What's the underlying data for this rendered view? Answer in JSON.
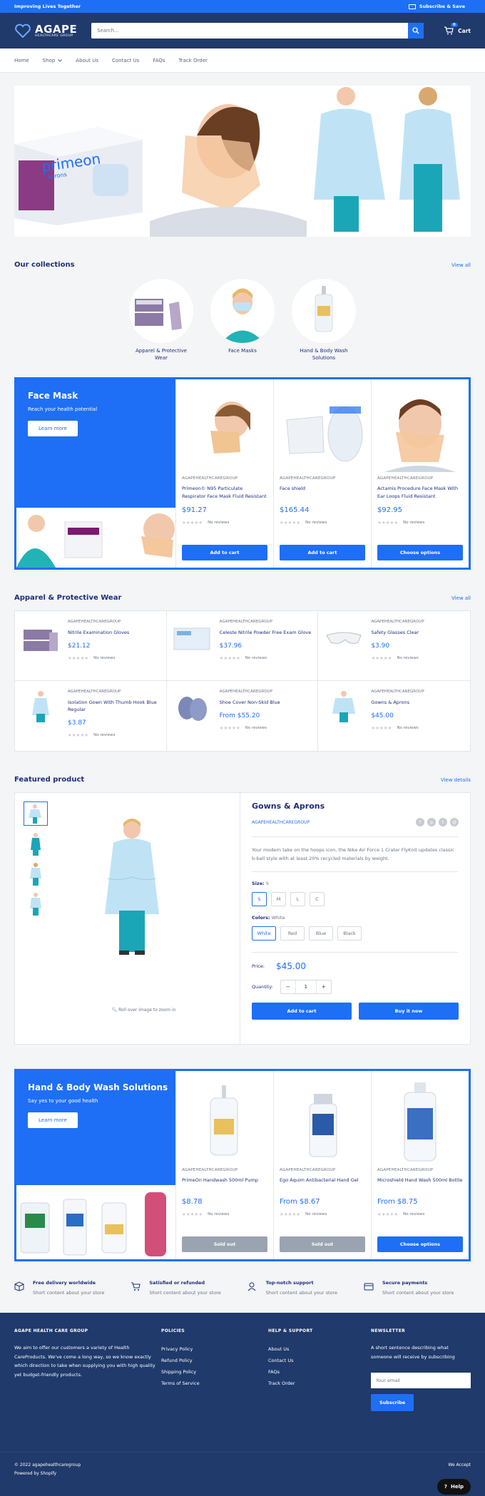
{
  "topbar": {
    "left": "Improving Lives Together",
    "right": "Subscribe & Save"
  },
  "header": {
    "logo": "AGAPE",
    "logo_sub": "HEALTHCARE GROUP",
    "search_placeholder": "Search...",
    "cart_label": "Cart",
    "cart_count": "0"
  },
  "nav": {
    "items": [
      "Home",
      "Shop",
      "About Us",
      "Contact Us",
      "FAQs",
      "Track Order"
    ]
  },
  "hero": {
    "box_brand": "primeon",
    "box_sub": "Aprons"
  },
  "collections": {
    "title": "Our collections",
    "view_all": "View all",
    "items": [
      "Apparel & Protective Wear",
      "Face Masks",
      "Hand & Body Wash Solutions"
    ]
  },
  "promo1": {
    "title": "Face Mask",
    "subtitle": "Reach your health potential",
    "button": "Learn more",
    "products": [
      {
        "vendor": "AGAPEHEALTHCAREGROUP",
        "name": "Primeon© N95 Particulate Respirator Face Mask Fluid Resistant",
        "price": "$91.27",
        "reviews": "No reviews",
        "button": "Add to cart"
      },
      {
        "vendor": "AGAPEHEALTHCAREGROUP",
        "name": "Face shield",
        "price": "$165.44",
        "reviews": "No reviews",
        "button": "Add to cart"
      },
      {
        "vendor": "AGAPEHEALTHCAREGROUP",
        "name": "Actamis Procedure Face Mask With Ear Loops Fluid Resistant",
        "price": "$92.95",
        "reviews": "No reviews",
        "button": "Choose options"
      }
    ]
  },
  "apparel": {
    "title": "Apparel & Protective Wear",
    "view_all": "View all",
    "items": [
      {
        "vendor": "AGAPEHEALTHCAREGROUP",
        "name": "Nitrile Examination Gloves",
        "price": "$21.12",
        "reviews": "No reviews"
      },
      {
        "vendor": "AGAPEHEALTHCAREGROUP",
        "name": "Celeste Nitrile Powder Free Exam Glove",
        "price": "$37.96",
        "reviews": "No reviews"
      },
      {
        "vendor": "AGAPEHEALTHCAREGROUP",
        "name": "Safety Glasses Clear",
        "price": "$3.90",
        "reviews": "No reviews"
      },
      {
        "vendor": "AGAPEHEALTHCAREGROUP",
        "name": "Isolation Gown With Thumb Hook Blue Regular",
        "price": "$3.87",
        "reviews": "No reviews"
      },
      {
        "vendor": "AGAPEHEALTHCAREGROUP",
        "name": "Shoe Cover Non-Skid Blue",
        "price": "From $55.20",
        "reviews": "No reviews"
      },
      {
        "vendor": "AGAPEHEALTHCAREGROUP",
        "name": "Gowns & Aprons",
        "price": "$45.00",
        "reviews": "No reviews"
      }
    ]
  },
  "featured": {
    "section_title": "Featured product",
    "view_details": "View details",
    "title": "Gowns & Aprons",
    "vendor": "AGAPEHEALTHCAREGROUP",
    "description": "Your modern take on the hoops icon, the Nike Air Force 1 Crater FlyKnit updates classic b-ball style with at least 20% recycled materials by weight.",
    "size_label": "Size:",
    "size_value": "S",
    "sizes": [
      "S",
      "M",
      "L",
      "C"
    ],
    "color_label": "Colors:",
    "color_value": "White",
    "colors": [
      "White",
      "Red",
      "Blue",
      "Black"
    ],
    "price_label": "Price:",
    "price": "$45.00",
    "qty_label": "Quantity:",
    "qty": "1",
    "zoom_hint": "Roll over image to zoom in",
    "add_to_cart": "Add to cart",
    "buy_now": "Buy it now"
  },
  "promo2": {
    "title": "Hand & Body Wash Solutions",
    "subtitle": "Say yes to your good health",
    "button": "Learn more",
    "products": [
      {
        "vendor": "AGAPEHEALTHCAREGROUP",
        "name": "PrimeOn Handwash 500ml Pump",
        "price": "$8.78",
        "reviews": "No reviews",
        "button": "Sold out"
      },
      {
        "vendor": "AGAPEHEALTHCAREGROUP",
        "name": "Ego Aquim Antibacterial Hand Gel",
        "price": "From $8.67",
        "reviews": "No reviews",
        "button": "Sold out"
      },
      {
        "vendor": "AGAPEHEALTHCAREGROUP",
        "name": "Microshield Hand Wash 500ml Bottle",
        "price": "From $8.75",
        "reviews": "No reviews",
        "button": "Choose options"
      }
    ]
  },
  "features": [
    {
      "title": "Free delivery worldwide",
      "text": "Short content about your store",
      "icon": "box-icon"
    },
    {
      "title": "Satisfied or refunded",
      "text": "Short content about your store",
      "icon": "cart-icon"
    },
    {
      "title": "Top-notch support",
      "text": "Short content about your store",
      "icon": "support-icon"
    },
    {
      "title": "Secure payments",
      "text": "Short content about your store",
      "icon": "payment-icon"
    }
  ],
  "footer": {
    "about_title": "AGAPE HEALTH CARE GROUP",
    "about_text": "We aim to offer our customers a variety of Health CareProducts. We've come a long way, so we know exactly which direction to take when supplying you with high quality yet budget-friendly products.",
    "policies_title": "POLICIES",
    "policies": [
      "Privacy Policy",
      "Refund Policy",
      "Shipping Policy",
      "Terms of Service"
    ],
    "help_title": "HELP & SUPPORT",
    "help": [
      "About Us",
      "Contact Us",
      "FAQs",
      "Track Order"
    ],
    "newsletter_title": "NEWSLETTER",
    "newsletter_text": "A short sentence describing what someone will receive by subscribing",
    "email_placeholder": "Your email",
    "subscribe": "Subscribe"
  },
  "bottom": {
    "copyright": "© 2022 agapehealthcaregroup",
    "powered": "Powered by Shopify",
    "we_accept": "We Accept",
    "help": "Help"
  },
  "colors": {
    "accent": "#1e6ff5",
    "navy": "#1f3a6b",
    "text": "#1e2d7d"
  }
}
